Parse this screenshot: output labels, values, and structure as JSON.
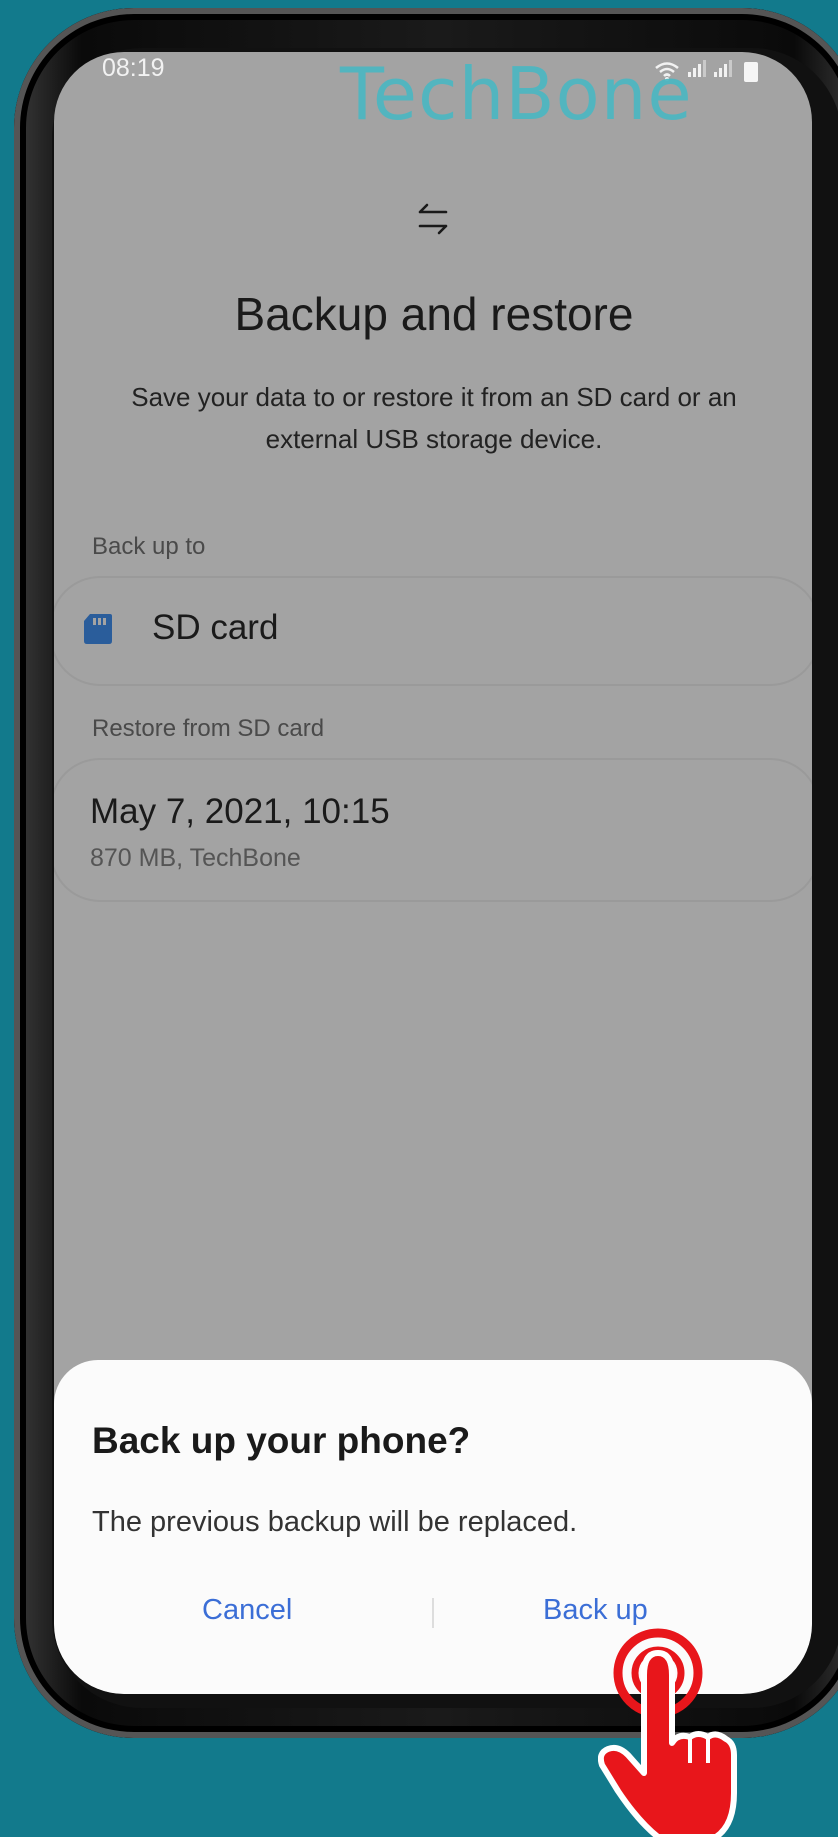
{
  "status_bar": {
    "time": "08:19"
  },
  "watermark": {
    "text": "TechBone"
  },
  "icons": {
    "transfer": "transfer-arrows-icon",
    "sd_card": "sd-card-icon",
    "tap_hand": "tap-hand-icon"
  },
  "header": {
    "title": "Backup and restore",
    "description": "Save your data to or restore it from an SD card or an external USB storage device."
  },
  "backup_section": {
    "label": "Back up to",
    "target": "SD card"
  },
  "restore_section": {
    "label": "Restore from SD card",
    "backup_date": "May 7, 2021, 10:15",
    "backup_meta": "870 MB, TechBone"
  },
  "dialog": {
    "title": "Back up your phone?",
    "message": "The previous backup will be replaced.",
    "cancel_label": "Cancel",
    "confirm_label": "Back up"
  },
  "colors": {
    "background": "#127a8c",
    "accent": "#3b6ed6",
    "sd_icon": "#2a5d9b",
    "watermark": "#4fb7c1",
    "hand": "#e8161b"
  }
}
